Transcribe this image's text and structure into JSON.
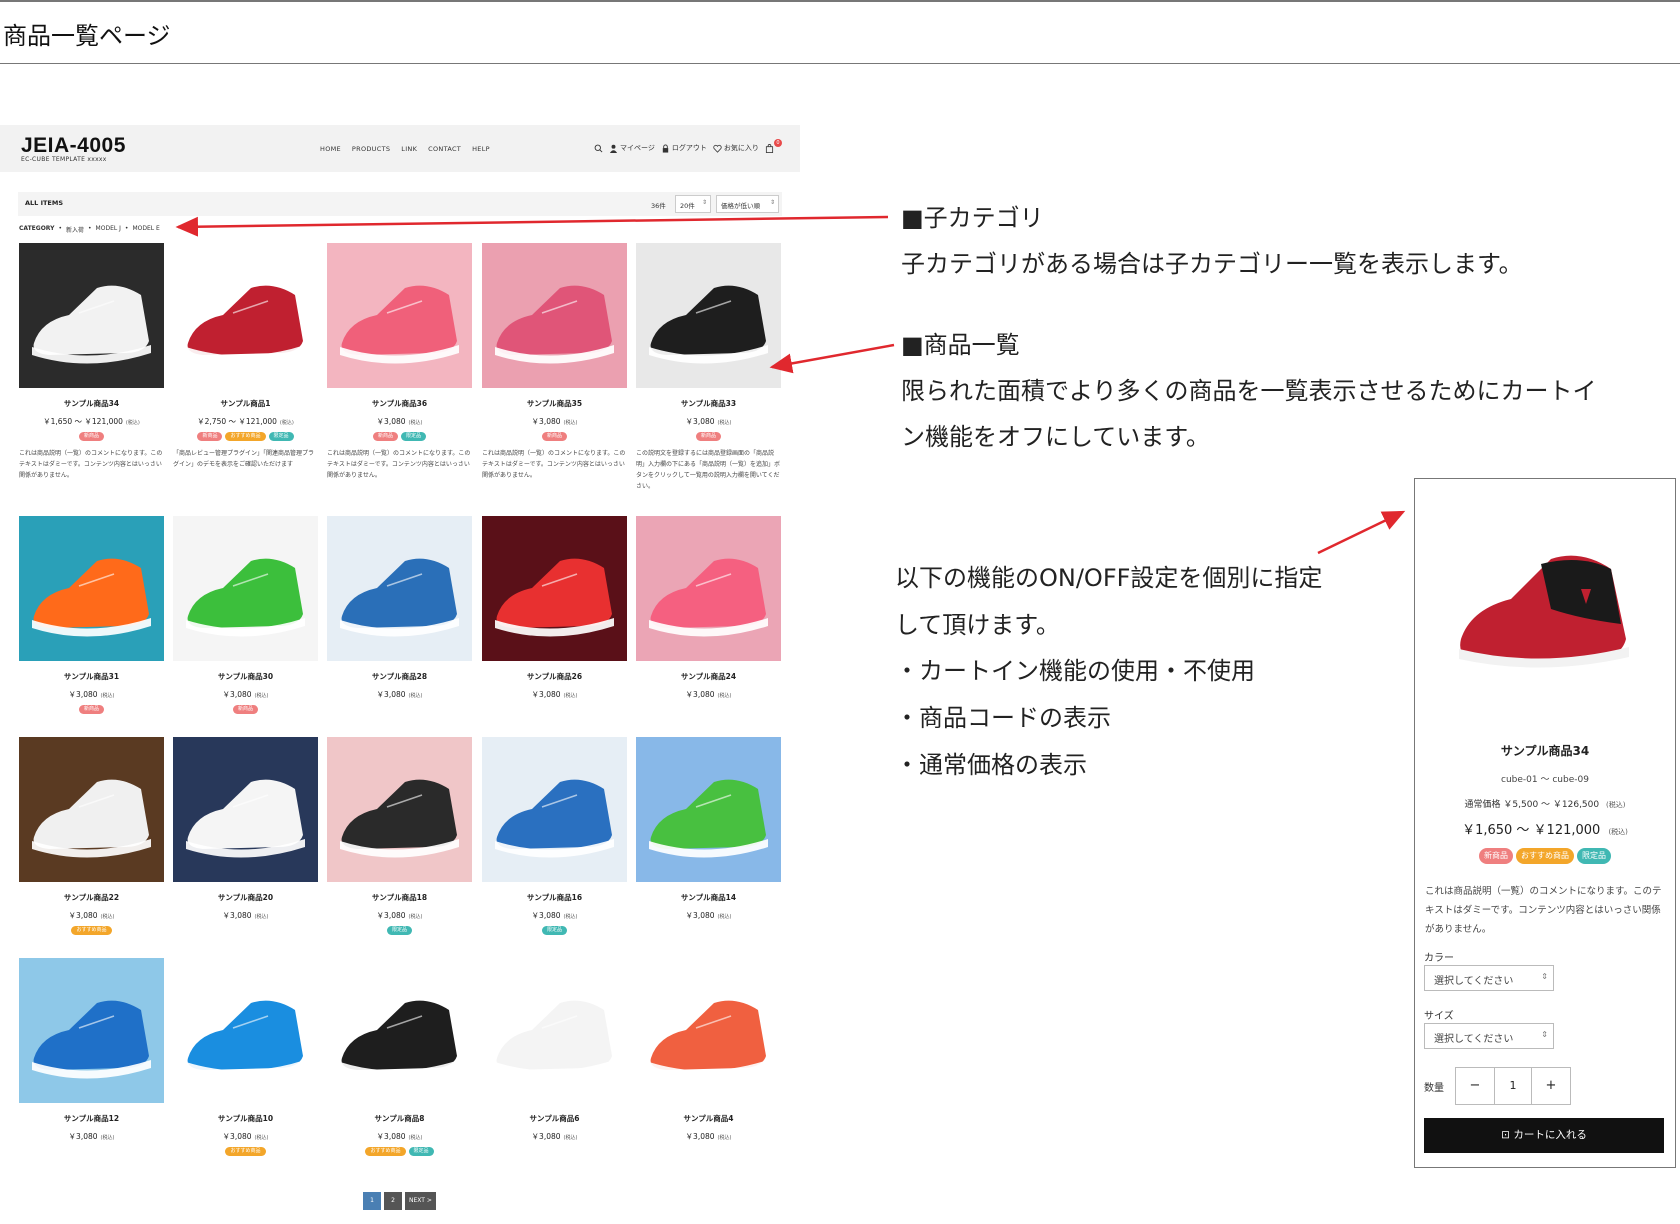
{
  "page_title": "商品一覧ページ",
  "shop": {
    "logo": "JEIA-4005",
    "logo_sub": "EC-CUBE TEMPLATE xxxxx",
    "nav": [
      "HOME",
      "PRODUCTS",
      "LINK",
      "CONTACT",
      "HELP"
    ],
    "util": {
      "mypage": "マイページ",
      "logout": "ログアウト",
      "favorite": "お気に入り",
      "cart_count": "0"
    },
    "toolbar": {
      "all_items": "ALL ITEMS",
      "count": "36件",
      "per_page": "20件",
      "sort": "価格が低い順"
    },
    "breadcrumb": [
      "CATEGORY",
      "新入荷",
      "MODEL J",
      "MODEL E"
    ],
    "badge_labels": {
      "new": "新商品",
      "rec": "おすすめ商品",
      "lim": "限定品"
    },
    "tax": "(税込)",
    "products": [
      {
        "name": "サンプル商品34",
        "price": "￥1,650 ～ ￥121,000",
        "badges": [
          "new"
        ],
        "desc": "これは商品説明（一覧）のコメントになります。このテキストはダミーです。コンテンツ内容とはいっさい関係がありません。",
        "color": "#3a3a3a",
        "bg": "#2b2b2b",
        "shoe": "#f2f2f2"
      },
      {
        "name": "サンプル商品1",
        "price": "￥2,750 ～ ￥121,000",
        "badges": [
          "new",
          "rec",
          "lim"
        ],
        "desc": "「商品レビュー管理プラグイン」「関連商品管理プラグイン」のデモを表示をご確認いただけます",
        "bg": "#ffffff",
        "shoe": "#c02030"
      },
      {
        "name": "サンプル商品36",
        "price": "￥3,080",
        "badges": [
          "new",
          "lim"
        ],
        "desc": "これは商品説明（一覧）のコメントになります。このテキストはダミーです。コンテンツ内容とはいっさい関係がありません。",
        "bg": "#f3b5c0",
        "shoe": "#f0607a"
      },
      {
        "name": "サンプル商品35",
        "price": "￥3,080",
        "badges": [
          "new"
        ],
        "desc": "これは商品説明（一覧）のコメントになります。このテキストはダミーです。コンテンツ内容とはいっさい関係がありません。",
        "bg": "#eba0b0",
        "shoe": "#e05578"
      },
      {
        "name": "サンプル商品33",
        "price": "￥3,080",
        "badges": [
          "new"
        ],
        "desc": "この説明文を登録するには商品登録画面の「商品説明」入力欄の下にある「商品説明（一覧）を追加」ボタンをクリックして一覧用の説明入力欄を開いてください。",
        "bg": "#e8e8e8",
        "shoe": "#1e1e1e"
      },
      {
        "name": "サンプル商品31",
        "price": "￥3,080",
        "badges": [
          "new"
        ],
        "desc": "",
        "bg": "#2aa0b8",
        "shoe": "#ff6a1a"
      },
      {
        "name": "サンプル商品30",
        "price": "￥3,080",
        "badges": [
          "new"
        ],
        "desc": "",
        "bg": "#f5f5f5",
        "shoe": "#3cbf3c"
      },
      {
        "name": "サンプル商品28",
        "price": "￥3,080",
        "badges": [],
        "desc": "",
        "bg": "#e6eef5",
        "shoe": "#2a6fb8"
      },
      {
        "name": "サンプル商品26",
        "price": "￥3,080",
        "badges": [],
        "desc": "",
        "bg": "#5a1018",
        "shoe": "#e83030"
      },
      {
        "name": "サンプル商品24",
        "price": "￥3,080",
        "badges": [],
        "desc": "",
        "bg": "#eba5b5",
        "shoe": "#f56080"
      },
      {
        "name": "サンプル商品22",
        "price": "￥3,080",
        "badges": [
          "rec"
        ],
        "desc": "",
        "bg": "#5a3a22",
        "shoe": "#f0f0f0"
      },
      {
        "name": "サンプル商品20",
        "price": "￥3,080",
        "badges": [],
        "desc": "",
        "bg": "#28385a",
        "shoe": "#f5f5f5"
      },
      {
        "name": "サンプル商品18",
        "price": "￥3,080",
        "badges": [
          "lim"
        ],
        "desc": "",
        "bg": "#f0c6c8",
        "shoe": "#2a2a2a"
      },
      {
        "name": "サンプル商品16",
        "price": "￥3,080",
        "badges": [
          "lim"
        ],
        "desc": "",
        "bg": "#e6eef5",
        "shoe": "#2a70c0"
      },
      {
        "name": "サンプル商品14",
        "price": "￥3,080",
        "badges": [],
        "desc": "",
        "bg": "#88b8e8",
        "shoe": "#48c040"
      },
      {
        "name": "サンプル商品12",
        "price": "￥3,080",
        "badges": [],
        "desc": "",
        "bg": "#8ec8e8",
        "shoe": "#1f70c8"
      },
      {
        "name": "サンプル商品10",
        "price": "￥3,080",
        "badges": [
          "rec"
        ],
        "desc": "",
        "bg": "#ffffff",
        "shoe": "#1a8ee0"
      },
      {
        "name": "サンプル商品8",
        "price": "￥3,080",
        "badges": [
          "rec",
          "lim"
        ],
        "desc": "",
        "bg": "#ffffff",
        "shoe": "#1e1e1e"
      },
      {
        "name": "サンプル商品6",
        "price": "￥3,080",
        "badges": [],
        "desc": "",
        "bg": "#ffffff",
        "shoe": "#f4f4f4"
      },
      {
        "name": "サンプル商品4",
        "price": "￥3,080",
        "badges": [],
        "desc": "",
        "bg": "#ffffff",
        "shoe": "#f06040"
      }
    ],
    "pager": [
      "1",
      "2",
      "NEXT >"
    ]
  },
  "annotations": {
    "subcat_title": "■子カテゴリ",
    "subcat_body": "子カテゴリがある場合は子カテゴリー一覧を表示します。",
    "list_title": "■商品一覧",
    "list_body_1": "限られた面積でより多くの商品を一覧表示させるためにカートイ",
    "list_body_2": "ン機能をオフにしています。",
    "onoff_1": "以下の機能のON/OFF設定を個別に指定",
    "onoff_2": "して頂けます。",
    "onoff_3": "・カートイン機能の使用・不使用",
    "onoff_4": "・商品コードの表示",
    "onoff_5": "・通常価格の表示",
    "arrow_color": "#e0282e"
  },
  "detail": {
    "name": "サンプル商品34",
    "code": "cube-01 ～ cube-09",
    "regular_label": "通常価格",
    "regular_price": "￥5,500 ～ ￥126,500",
    "price": "￥1,650 ～ ￥121,000",
    "tax": "(税込)",
    "badges": [
      "新商品",
      "おすすめ商品",
      "限定品"
    ],
    "desc": "これは商品説明（一覧）のコメントになります。このテキストはダミーです。コンテンツ内容とはいっさい関係がありません。",
    "color_label": "カラー",
    "color_placeholder": "選択してください",
    "size_label": "サイズ",
    "size_placeholder": "選択してください",
    "qty_label": "数量",
    "qty_minus": "−",
    "qty_value": "1",
    "qty_plus": "+",
    "cart_button": "カートに入れる"
  }
}
